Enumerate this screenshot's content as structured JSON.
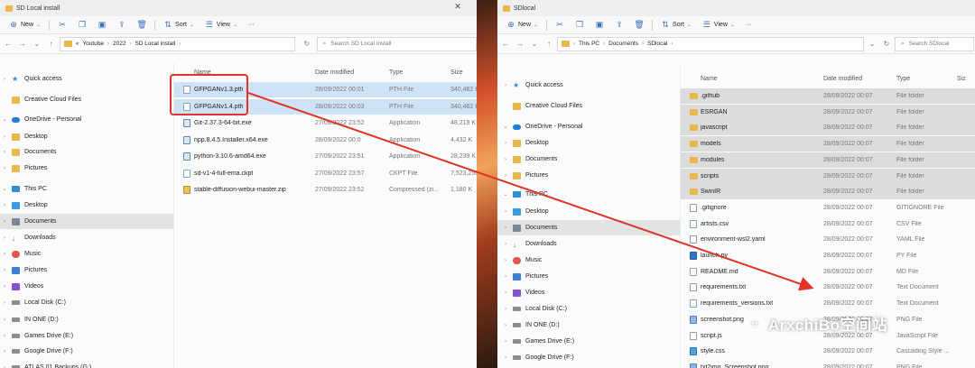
{
  "left": {
    "title": "SD Local install",
    "toolbar": {
      "new": "New",
      "sort": "Sort",
      "view": "View",
      "more": "···"
    },
    "breadcrumb": [
      "Youtube",
      "2022",
      "SD Local install"
    ],
    "breadcrumb_overflow": "«",
    "search_placeholder": "Search SD Local install",
    "nav": [
      {
        "label": "Quick access",
        "icon": "star-icon"
      },
      {
        "label": "Creative Cloud Files",
        "icon": "creative-cloud-icon"
      },
      {
        "label": "OneDrive - Personal",
        "icon": "cloud-icon"
      },
      {
        "label": "Desktop",
        "icon": "folder-icon"
      },
      {
        "label": "Documents",
        "icon": "folder-icon"
      },
      {
        "label": "Pictures",
        "icon": "folder-icon"
      },
      {
        "label": "This PC",
        "icon": "computer-icon"
      },
      {
        "label": "Desktop",
        "icon": "desktop-icon"
      },
      {
        "label": "Documents",
        "icon": "documents-icon"
      },
      {
        "label": "Downloads",
        "icon": "download-icon"
      },
      {
        "label": "Music",
        "icon": "music-icon"
      },
      {
        "label": "Pictures",
        "icon": "pictures-icon"
      },
      {
        "label": "Videos",
        "icon": "videos-icon"
      },
      {
        "label": "Local Disk (C:)",
        "icon": "disk-icon"
      },
      {
        "label": "IN ONE (D:)",
        "icon": "disk-icon"
      },
      {
        "label": "Games Drive (E:)",
        "icon": "disk-icon"
      },
      {
        "label": "Google Drive (F:)",
        "icon": "disk-icon"
      },
      {
        "label": "ATLAS 01 Backups (G:)",
        "icon": "disk-icon"
      }
    ],
    "columns": [
      "Name",
      "Date modified",
      "Type",
      "Size"
    ],
    "files": [
      {
        "name": "GFPGANv1.3.pth",
        "date": "28/09/2022 00:01",
        "type": "PTH File",
        "size": "340,462 K",
        "icon": "file",
        "state": "sel"
      },
      {
        "name": "GFPGANv1.4.pth",
        "date": "28/09/2022 00:03",
        "type": "PTH File",
        "size": "340,462 K",
        "icon": "file",
        "state": "sel"
      },
      {
        "name": "Git-2.37.3-64-bit.exe",
        "date": "27/09/2022 23:52",
        "type": "Application",
        "size": "48,219 K",
        "icon": "exe",
        "state": ""
      },
      {
        "name": "npp.8.4.5.Installer.x64.exe",
        "date": "28/09/2022 00:0",
        "type": "Application",
        "size": "4,432 K",
        "icon": "exe",
        "state": ""
      },
      {
        "name": "python-3.10.6-amd64.exe",
        "date": "27/09/2022 23:51",
        "type": "Application",
        "size": "28,239 K",
        "icon": "exe",
        "state": ""
      },
      {
        "name": "sd-v1-4-full-ema.ckpt",
        "date": "27/09/2022 23:57",
        "type": "CKPT File",
        "size": "7,523,250 K",
        "icon": "file",
        "state": ""
      },
      {
        "name": "stable-diffusion-webui-master.zip",
        "date": "27/09/2022 23:52",
        "type": "Compressed (zi...",
        "size": "1,180 K",
        "icon": "zip",
        "state": ""
      }
    ]
  },
  "right": {
    "title": "SDlocal",
    "toolbar": {
      "new": "New",
      "sort": "Sort",
      "view": "View",
      "more": "···"
    },
    "breadcrumb": [
      "This PC",
      "Documents",
      "SDlocal"
    ],
    "search_placeholder": "Search SDlocal",
    "nav": [
      {
        "label": "Quick access",
        "icon": "star-icon"
      },
      {
        "label": "Creative Cloud Files",
        "icon": "creative-cloud-icon"
      },
      {
        "label": "OneDrive - Personal",
        "icon": "cloud-icon"
      },
      {
        "label": "Desktop",
        "icon": "folder-icon"
      },
      {
        "label": "Documents",
        "icon": "folder-icon"
      },
      {
        "label": "Pictures",
        "icon": "folder-icon"
      },
      {
        "label": "This PC",
        "icon": "computer-icon"
      },
      {
        "label": "Desktop",
        "icon": "desktop-icon"
      },
      {
        "label": "Documents",
        "icon": "documents-icon"
      },
      {
        "label": "Downloads",
        "icon": "download-icon"
      },
      {
        "label": "Music",
        "icon": "music-icon"
      },
      {
        "label": "Pictures",
        "icon": "pictures-icon"
      },
      {
        "label": "Videos",
        "icon": "videos-icon"
      },
      {
        "label": "Local Disk (C:)",
        "icon": "disk-icon"
      },
      {
        "label": "IN ONE (D:)",
        "icon": "disk-icon"
      },
      {
        "label": "Games Drive (E:)",
        "icon": "disk-icon"
      },
      {
        "label": "Google Drive (F:)",
        "icon": "disk-icon"
      }
    ],
    "columns": [
      "Name",
      "Date modified",
      "Type",
      "Siz"
    ],
    "files": [
      {
        "name": ".github",
        "date": "28/09/2022 00:07",
        "type": "File folder",
        "icon": "folder",
        "state": "gray"
      },
      {
        "name": "ESRGAN",
        "date": "28/09/2022 00:07",
        "type": "File folder",
        "icon": "folder",
        "state": "gray"
      },
      {
        "name": "javascript",
        "date": "28/09/2022 00:07",
        "type": "File folder",
        "icon": "folder",
        "state": "gray"
      },
      {
        "name": "models",
        "date": "28/09/2022 00:07",
        "type": "File folder",
        "icon": "folder",
        "state": "gray"
      },
      {
        "name": "modules",
        "date": "28/09/2022 00:07",
        "type": "File folder",
        "icon": "folder",
        "state": "gray"
      },
      {
        "name": "scripts",
        "date": "28/09/2022 00:07",
        "type": "File folder",
        "icon": "folder",
        "state": "gray"
      },
      {
        "name": "SwinIR",
        "date": "28/09/2022 00:07",
        "type": "File folder",
        "icon": "folder",
        "state": "gray"
      },
      {
        "name": ".gitignore",
        "date": "28/09/2022 00:07",
        "type": "GITIGNORE File",
        "icon": "file",
        "state": ""
      },
      {
        "name": "artists.csv",
        "date": "28/09/2022 00:07",
        "type": "CSV File",
        "icon": "file",
        "state": ""
      },
      {
        "name": "environment-wsl2.yaml",
        "date": "28/09/2022 00:07",
        "type": "YAML File",
        "icon": "file",
        "state": ""
      },
      {
        "name": "launch.py",
        "date": "28/09/2022 00:07",
        "type": "PY File",
        "icon": "py",
        "state": ""
      },
      {
        "name": "README.md",
        "date": "28/09/2022 00:07",
        "type": "MD File",
        "icon": "file",
        "state": ""
      },
      {
        "name": "requirements.txt",
        "date": "28/09/2022 00:07",
        "type": "Text Document",
        "icon": "file",
        "state": ""
      },
      {
        "name": "requirements_versions.txt",
        "date": "28/09/2022 00:07",
        "type": "Text Document",
        "icon": "file",
        "state": ""
      },
      {
        "name": "screenshot.png",
        "date": "28/09/2022 00:07",
        "type": "PNG File",
        "icon": "img",
        "state": ""
      },
      {
        "name": "script.js",
        "date": "28/09/2022 00:07",
        "type": "JavaScript File",
        "icon": "file",
        "state": ""
      },
      {
        "name": "style.css",
        "date": "28/09/2022 00:07",
        "type": "Cascading Style ...",
        "icon": "css",
        "state": ""
      },
      {
        "name": "txt2img_Screenshot.png",
        "date": "28/09/2022 00:07",
        "type": "PNG File",
        "icon": "img",
        "state": ""
      }
    ]
  },
  "watermark": "ArxchiBo空间站"
}
